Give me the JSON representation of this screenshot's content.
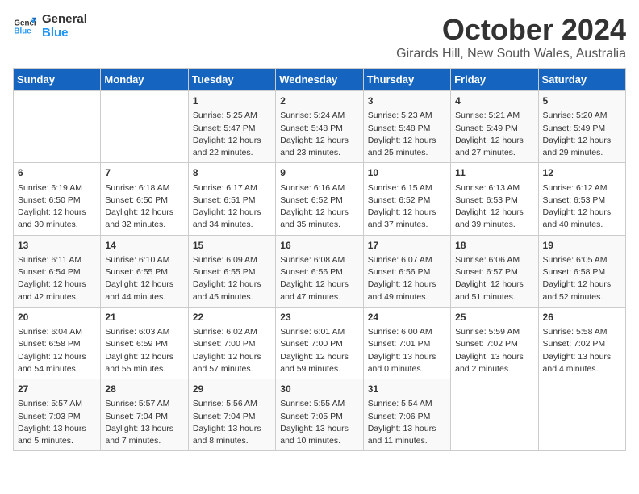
{
  "header": {
    "logo_line1": "General",
    "logo_line2": "Blue",
    "month": "October 2024",
    "location": "Girards Hill, New South Wales, Australia"
  },
  "days_of_week": [
    "Sunday",
    "Monday",
    "Tuesday",
    "Wednesday",
    "Thursday",
    "Friday",
    "Saturday"
  ],
  "weeks": [
    [
      {
        "day": "",
        "info": ""
      },
      {
        "day": "",
        "info": ""
      },
      {
        "day": "1",
        "info": "Sunrise: 5:25 AM\nSunset: 5:47 PM\nDaylight: 12 hours\nand 22 minutes."
      },
      {
        "day": "2",
        "info": "Sunrise: 5:24 AM\nSunset: 5:48 PM\nDaylight: 12 hours\nand 23 minutes."
      },
      {
        "day": "3",
        "info": "Sunrise: 5:23 AM\nSunset: 5:48 PM\nDaylight: 12 hours\nand 25 minutes."
      },
      {
        "day": "4",
        "info": "Sunrise: 5:21 AM\nSunset: 5:49 PM\nDaylight: 12 hours\nand 27 minutes."
      },
      {
        "day": "5",
        "info": "Sunrise: 5:20 AM\nSunset: 5:49 PM\nDaylight: 12 hours\nand 29 minutes."
      }
    ],
    [
      {
        "day": "6",
        "info": "Sunrise: 6:19 AM\nSunset: 6:50 PM\nDaylight: 12 hours\nand 30 minutes."
      },
      {
        "day": "7",
        "info": "Sunrise: 6:18 AM\nSunset: 6:50 PM\nDaylight: 12 hours\nand 32 minutes."
      },
      {
        "day": "8",
        "info": "Sunrise: 6:17 AM\nSunset: 6:51 PM\nDaylight: 12 hours\nand 34 minutes."
      },
      {
        "day": "9",
        "info": "Sunrise: 6:16 AM\nSunset: 6:52 PM\nDaylight: 12 hours\nand 35 minutes."
      },
      {
        "day": "10",
        "info": "Sunrise: 6:15 AM\nSunset: 6:52 PM\nDaylight: 12 hours\nand 37 minutes."
      },
      {
        "day": "11",
        "info": "Sunrise: 6:13 AM\nSunset: 6:53 PM\nDaylight: 12 hours\nand 39 minutes."
      },
      {
        "day": "12",
        "info": "Sunrise: 6:12 AM\nSunset: 6:53 PM\nDaylight: 12 hours\nand 40 minutes."
      }
    ],
    [
      {
        "day": "13",
        "info": "Sunrise: 6:11 AM\nSunset: 6:54 PM\nDaylight: 12 hours\nand 42 minutes."
      },
      {
        "day": "14",
        "info": "Sunrise: 6:10 AM\nSunset: 6:55 PM\nDaylight: 12 hours\nand 44 minutes."
      },
      {
        "day": "15",
        "info": "Sunrise: 6:09 AM\nSunset: 6:55 PM\nDaylight: 12 hours\nand 45 minutes."
      },
      {
        "day": "16",
        "info": "Sunrise: 6:08 AM\nSunset: 6:56 PM\nDaylight: 12 hours\nand 47 minutes."
      },
      {
        "day": "17",
        "info": "Sunrise: 6:07 AM\nSunset: 6:56 PM\nDaylight: 12 hours\nand 49 minutes."
      },
      {
        "day": "18",
        "info": "Sunrise: 6:06 AM\nSunset: 6:57 PM\nDaylight: 12 hours\nand 51 minutes."
      },
      {
        "day": "19",
        "info": "Sunrise: 6:05 AM\nSunset: 6:58 PM\nDaylight: 12 hours\nand 52 minutes."
      }
    ],
    [
      {
        "day": "20",
        "info": "Sunrise: 6:04 AM\nSunset: 6:58 PM\nDaylight: 12 hours\nand 54 minutes."
      },
      {
        "day": "21",
        "info": "Sunrise: 6:03 AM\nSunset: 6:59 PM\nDaylight: 12 hours\nand 55 minutes."
      },
      {
        "day": "22",
        "info": "Sunrise: 6:02 AM\nSunset: 7:00 PM\nDaylight: 12 hours\nand 57 minutes."
      },
      {
        "day": "23",
        "info": "Sunrise: 6:01 AM\nSunset: 7:00 PM\nDaylight: 12 hours\nand 59 minutes."
      },
      {
        "day": "24",
        "info": "Sunrise: 6:00 AM\nSunset: 7:01 PM\nDaylight: 13 hours\nand 0 minutes."
      },
      {
        "day": "25",
        "info": "Sunrise: 5:59 AM\nSunset: 7:02 PM\nDaylight: 13 hours\nand 2 minutes."
      },
      {
        "day": "26",
        "info": "Sunrise: 5:58 AM\nSunset: 7:02 PM\nDaylight: 13 hours\nand 4 minutes."
      }
    ],
    [
      {
        "day": "27",
        "info": "Sunrise: 5:57 AM\nSunset: 7:03 PM\nDaylight: 13 hours\nand 5 minutes."
      },
      {
        "day": "28",
        "info": "Sunrise: 5:57 AM\nSunset: 7:04 PM\nDaylight: 13 hours\nand 7 minutes."
      },
      {
        "day": "29",
        "info": "Sunrise: 5:56 AM\nSunset: 7:04 PM\nDaylight: 13 hours\nand 8 minutes."
      },
      {
        "day": "30",
        "info": "Sunrise: 5:55 AM\nSunset: 7:05 PM\nDaylight: 13 hours\nand 10 minutes."
      },
      {
        "day": "31",
        "info": "Sunrise: 5:54 AM\nSunset: 7:06 PM\nDaylight: 13 hours\nand 11 minutes."
      },
      {
        "day": "",
        "info": ""
      },
      {
        "day": "",
        "info": ""
      }
    ]
  ]
}
